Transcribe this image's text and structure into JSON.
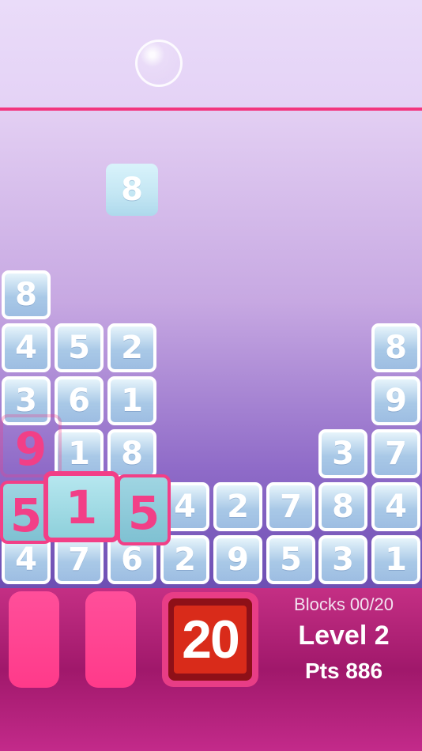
{
  "hud": {
    "blocks_counter": "Blocks 00/20",
    "level": "Level 2",
    "points": "Pts 886",
    "timer": "20"
  },
  "falling_block": {
    "value": "8"
  },
  "board": {
    "rows": [
      {
        "row": 1,
        "cells": [
          "8",
          "",
          "",
          "",
          "",
          "",
          "",
          ""
        ]
      },
      {
        "row": 2,
        "cells": [
          "4",
          "5",
          "2",
          "",
          "",
          "",
          "",
          "8"
        ]
      },
      {
        "row": 3,
        "cells": [
          "3",
          "6",
          "1",
          "",
          "",
          "",
          "",
          "9"
        ]
      },
      {
        "row": 4,
        "cells": [
          "9",
          "1",
          "8",
          "",
          "",
          "",
          "3",
          "7"
        ]
      },
      {
        "row": 5,
        "cells": [
          "5",
          "1",
          "5",
          "4",
          "2",
          "7",
          "8",
          "4"
        ]
      },
      {
        "row": 6,
        "cells": [
          "4",
          "7",
          "6",
          "2",
          "9",
          "5",
          "3",
          "1"
        ]
      }
    ]
  },
  "selection": {
    "values": [
      "5",
      "1",
      "5"
    ],
    "above": "9"
  },
  "colors": {
    "limit_line": "#f2367f",
    "selection": "#f23f87",
    "timer_bg": "#d92b1a",
    "hud_bg": "#a0186b"
  }
}
